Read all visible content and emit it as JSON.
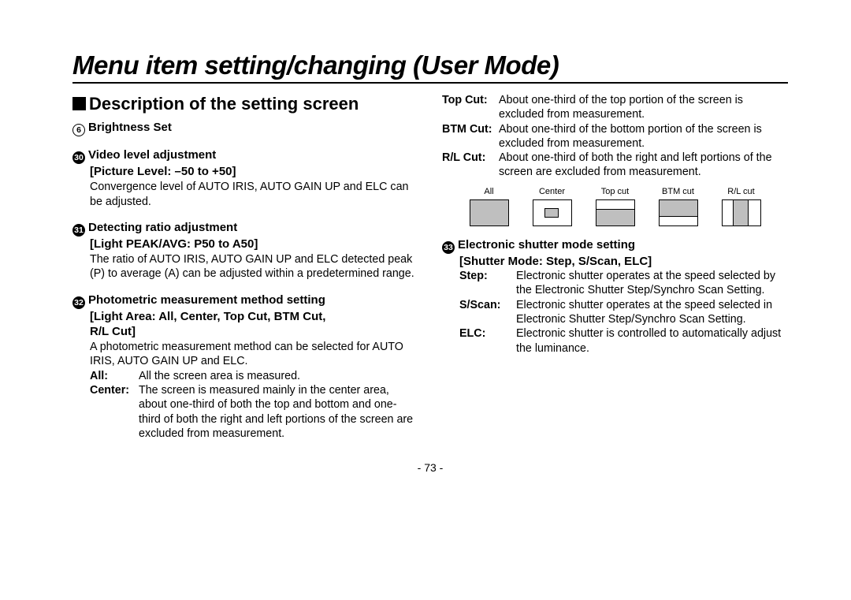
{
  "title": "Menu item setting/changing (User Mode)",
  "section_title": "Description of the setting screen",
  "item6": {
    "num": "6",
    "title": "Brightness Set"
  },
  "item30": {
    "num": "30",
    "title": "Video level adjustment",
    "param": "[Picture Level: –50 to +50]",
    "body": "Convergence level of AUTO IRIS, AUTO GAIN UP and ELC can be adjusted."
  },
  "item31": {
    "num": "31",
    "title": "Detecting ratio adjustment",
    "param": "[Light PEAK/AVG: P50 to A50]",
    "body": "The ratio of AUTO IRIS, AUTO GAIN UP and ELC detected peak (P) to average (A) can be adjusted within a predetermined range."
  },
  "item32": {
    "num": "32",
    "title": "Photometric measurement method setting",
    "param1": "[Light Area: All, Center, Top Cut, BTM Cut,",
    "param2": "R/L Cut]",
    "body": "A photometric measurement method can be selected for AUTO IRIS, AUTO GAIN UP and ELC.",
    "defs": {
      "all_k": "All:",
      "all_v": "All the screen area is measured.",
      "center_k": "Center:",
      "center_v": "The screen is measured mainly in the center area, about one-third of both the top and bottom and one-third of both the right and left portions of the screen are excluded from measurement.",
      "top_k": "Top Cut:",
      "top_v": "About one-third of the top portion of the screen is excluded from measurement.",
      "btm_k": "BTM Cut:",
      "btm_v": "About one-third of the bottom portion of the screen is excluded from measurement.",
      "rl_k": "R/L Cut:",
      "rl_v": "About one-third of both the right and left portions of the screen are excluded from measurement."
    }
  },
  "diagrams": {
    "all": "All",
    "center": "Center",
    "topcut": "Top cut",
    "btmcut": "BTM cut",
    "rlcut": "R/L cut"
  },
  "item33": {
    "num": "33",
    "title": "Electronic shutter mode setting",
    "param": "[Shutter Mode: Step, S/Scan, ELC]",
    "defs": {
      "step_k": "Step:",
      "step_v": "Electronic shutter operates at the speed selected by the Electronic Shutter Step/Synchro Scan Setting.",
      "sscan_k": "S/Scan:",
      "sscan_v": "Electronic shutter operates at the speed selected in Electronic Shutter Step/Synchro Scan Setting.",
      "elc_k": "ELC:",
      "elc_v": "Electronic shutter is controlled to automatically adjust the luminance."
    }
  },
  "pagenum": "- 73 -"
}
